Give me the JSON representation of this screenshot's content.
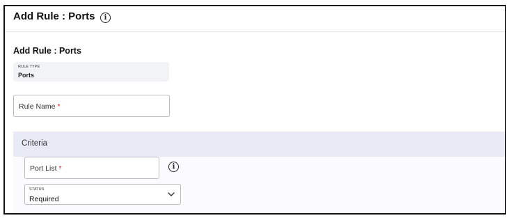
{
  "header": {
    "title": "Add Rule : Ports",
    "info_icon": "info-icon"
  },
  "form": {
    "section_title": "Add Rule : Ports",
    "rule_type": {
      "label": "RULE TYPE",
      "value": "Ports"
    },
    "rule_name": {
      "placeholder": "Rule Name",
      "required_mark": "*"
    }
  },
  "criteria": {
    "title": "Criteria",
    "port_list": {
      "placeholder": "Port List",
      "required_mark": "*",
      "info_icon": "info-icon"
    },
    "status": {
      "label": "STATUS",
      "value": "Required",
      "icon": "chevron-down-icon"
    }
  },
  "colors": {
    "required": "#d32020",
    "criteria_background": "#e8ebf6"
  }
}
